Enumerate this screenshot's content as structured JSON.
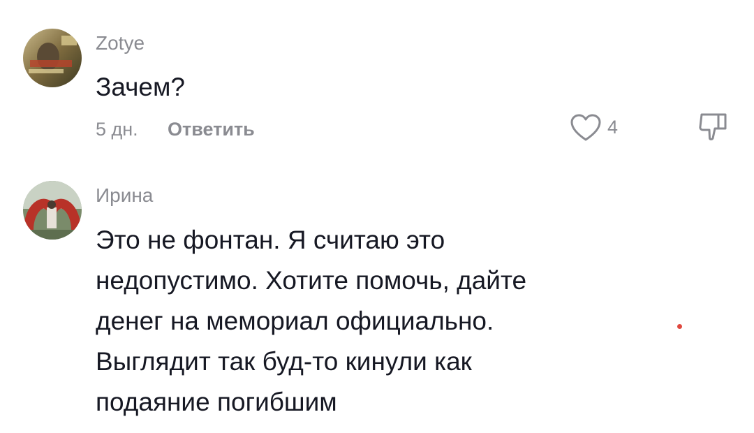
{
  "comments": [
    {
      "username": "Zotye",
      "lines": [
        "Зачем?"
      ],
      "age": "5 дн.",
      "reply_label": "Ответить",
      "likes": "4",
      "avatar_icon": "user-avatar-photo"
    },
    {
      "username": "Ирина",
      "lines": [
        "Это не фонтан. Я считаю это",
        "недопустимо. Хотите помочь, дайте",
        "денег на мемориал официально.",
        "Выглядит так буд-то кинули как",
        "подаяние погибшим"
      ],
      "avatar_icon": "user-avatar-photo"
    }
  ],
  "icons": {
    "like": "heart-outline-icon",
    "dislike": "thumbs-down-outline-icon"
  },
  "colors": {
    "primary_text": "#161823",
    "secondary_text": "#8a8b91",
    "marker": "#e0483f"
  }
}
